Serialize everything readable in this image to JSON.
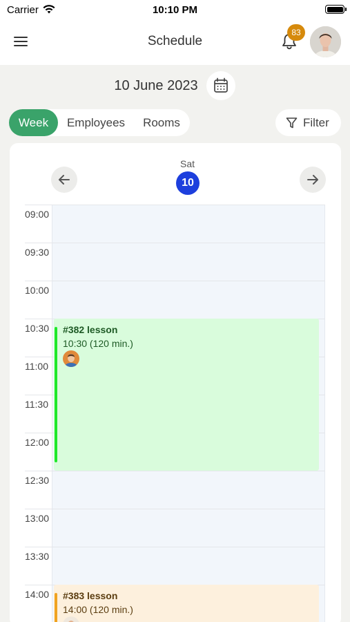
{
  "status_bar": {
    "carrier": "Carrier",
    "time": "10:10 PM"
  },
  "header": {
    "title": "Schedule",
    "notification_count": "83"
  },
  "date": {
    "label": "10 June 2023"
  },
  "view_tabs": [
    {
      "label": "Week",
      "active": true
    },
    {
      "label": "Employees",
      "active": false
    },
    {
      "label": "Rooms",
      "active": false
    }
  ],
  "filter": {
    "label": "Filter"
  },
  "day_header": {
    "day_name": "Sat",
    "day_number": "10"
  },
  "time_slots": [
    "09:00",
    "09:30",
    "10:00",
    "10:30",
    "11:00",
    "11:30",
    "12:00",
    "12:30",
    "13:00",
    "13:30",
    "14:00"
  ],
  "events": [
    {
      "title": "#382 lesson",
      "time": "10:30 (120 min.)",
      "color": "#d9fcdc",
      "accent": "#1ee82a",
      "text_color": "#1e5a25"
    },
    {
      "title": "#383 lesson",
      "time": "14:00 (120 min.)",
      "color": "#fdf0dd",
      "accent": "#f0a321",
      "text_color": "#5b3d10"
    }
  ],
  "colors": {
    "accent_green": "#3aa36a",
    "today_blue": "#1d3fdd",
    "badge_orange": "#d68a0c"
  },
  "icons": {
    "menu": "hamburger-icon",
    "notification": "bell-icon",
    "calendar": "calendar-icon",
    "filter": "funnel-icon",
    "prev": "arrow-left-icon",
    "next": "arrow-right-icon"
  }
}
